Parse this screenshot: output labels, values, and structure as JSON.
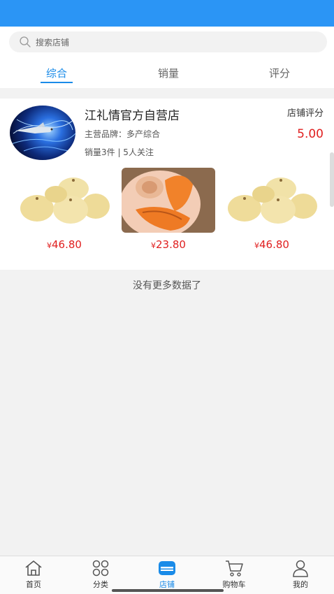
{
  "search": {
    "placeholder": "搜索店铺"
  },
  "tabs": [
    {
      "label": "综合",
      "active": true
    },
    {
      "label": "销量",
      "active": false
    },
    {
      "label": "评分",
      "active": false
    }
  ],
  "shop": {
    "name": "江礼情官方自营店",
    "rating_label": "店铺评分",
    "rating_value": "5.00",
    "brand": "主营品牌：多产综合",
    "stats": "销量3件 | 5人关注",
    "products": [
      {
        "image": "pears-icon",
        "currency": "¥",
        "price": "46.80"
      },
      {
        "image": "papaya-icon",
        "currency": "¥",
        "price": "23.80"
      },
      {
        "image": "pears-icon",
        "currency": "¥",
        "price": "46.80"
      }
    ]
  },
  "footer_message": "没有更多数据了",
  "tabbar": [
    {
      "label": "首页",
      "icon": "home-icon",
      "active": false
    },
    {
      "label": "分类",
      "icon": "category-icon",
      "active": false
    },
    {
      "label": "店铺",
      "icon": "store-icon",
      "active": true
    },
    {
      "label": "购物车",
      "icon": "cart-icon",
      "active": false
    },
    {
      "label": "我的",
      "icon": "user-icon",
      "active": false
    }
  ],
  "colors": {
    "accent": "#1a8be8",
    "status_bar": "#2b95f5",
    "price": "#e02020"
  }
}
